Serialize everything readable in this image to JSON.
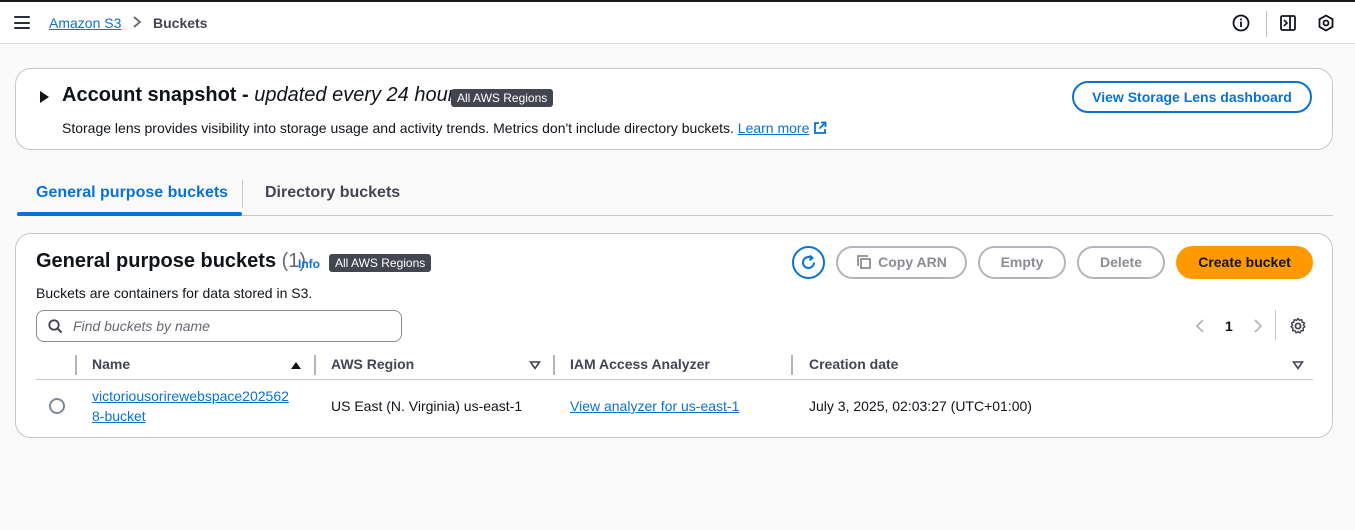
{
  "header": {
    "breadcrumb": {
      "parent": "Amazon S3",
      "current": "Buckets"
    },
    "icons": [
      "menu-icon",
      "info-circle-icon",
      "side-panel-icon",
      "hexagon-settings-icon"
    ]
  },
  "snapshot": {
    "title": "Account snapshot - ",
    "title_italic": "updated every 24 hours",
    "badge": "All AWS Regions",
    "description": "Storage lens provides visibility into storage usage and activity trends. Metrics don't include directory buckets.",
    "learn_more": "Learn more",
    "button": "View Storage Lens dashboard"
  },
  "tabs": [
    {
      "label": "General purpose buckets",
      "active": true
    },
    {
      "label": "Directory buckets",
      "active": false
    }
  ],
  "buckets": {
    "title": "General purpose buckets",
    "count": "(1)",
    "info": "Info",
    "badge": "All AWS Regions",
    "description": "Buckets are containers for data stored in S3.",
    "actions": {
      "copy_arn": "Copy ARN",
      "empty": "Empty",
      "delete": "Delete",
      "create": "Create bucket"
    },
    "search_placeholder": "Find buckets by name",
    "pagination": {
      "page": "1"
    },
    "columns": [
      "Name",
      "AWS Region",
      "IAM Access Analyzer",
      "Creation date"
    ],
    "rows": [
      {
        "name_line1": "victoriousorirewebspace202562",
        "name_line2": "8-bucket",
        "region": "US East (N. Virginia) us-east-1",
        "analyzer": "View analyzer for us-east-1",
        "created": "July 3, 2025, 02:03:27 (UTC+01:00)"
      }
    ]
  },
  "colors": {
    "accent": "#0972d3",
    "primary_button": "#ff9900",
    "badge": "#424650"
  }
}
